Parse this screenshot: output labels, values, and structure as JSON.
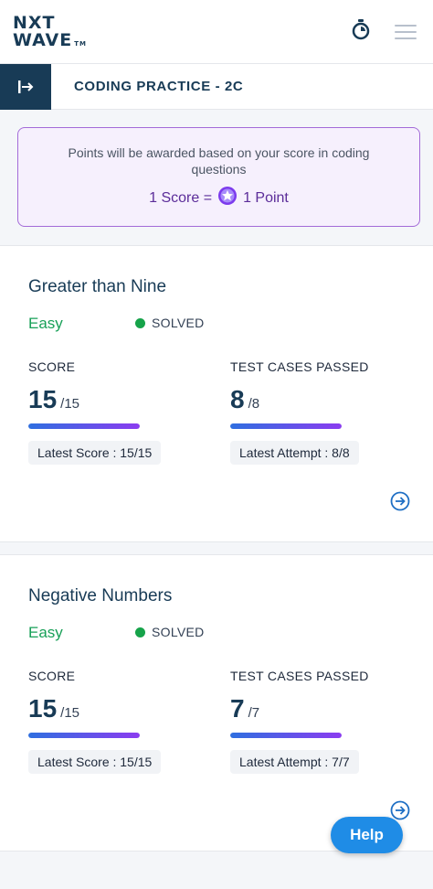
{
  "header": {
    "logo_top": "NXT",
    "logo_bottom": "WAVE",
    "logo_tm": "TM"
  },
  "subheader": {
    "title": "CODING PRACTICE - 2C"
  },
  "banner": {
    "text": "Points will be awarded based on your score in coding questions",
    "formula_left": "1 Score =",
    "formula_right": "1 Point"
  },
  "questions": [
    {
      "title": "Greater than Nine",
      "difficulty": "Easy",
      "status": "SOLVED",
      "score_label": "SCORE",
      "score": "15",
      "score_total": "/15",
      "score_progress": 1.0,
      "tests_label": "TEST CASES PASSED",
      "tests_passed": "8",
      "tests_total": "/8",
      "tests_progress": 1.0,
      "latest_score": "Latest Score : 15/15",
      "latest_attempt": "Latest Attempt : 8/8"
    },
    {
      "title": "Negative Numbers",
      "difficulty": "Easy",
      "status": "SOLVED",
      "score_label": "SCORE",
      "score": "15",
      "score_total": "/15",
      "score_progress": 1.0,
      "tests_label": "TEST CASES PASSED",
      "tests_passed": "7",
      "tests_total": "/7",
      "tests_progress": 1.0,
      "latest_score": "Latest Score : 15/15",
      "latest_attempt": "Latest Attempt : 7/7"
    }
  ],
  "help": {
    "label": "Help"
  },
  "colors": {
    "brand": "#183b56",
    "accent_purple": "#8b3cf0",
    "easy_green": "#18a058",
    "help_blue": "#1f8ce6"
  },
  "icons": {
    "timer": "stopwatch-icon",
    "menu": "hamburger-menu-icon",
    "back": "collapse-sidebar-icon",
    "star": "star-coin-icon",
    "arrow": "arrow-right-circle-icon"
  }
}
